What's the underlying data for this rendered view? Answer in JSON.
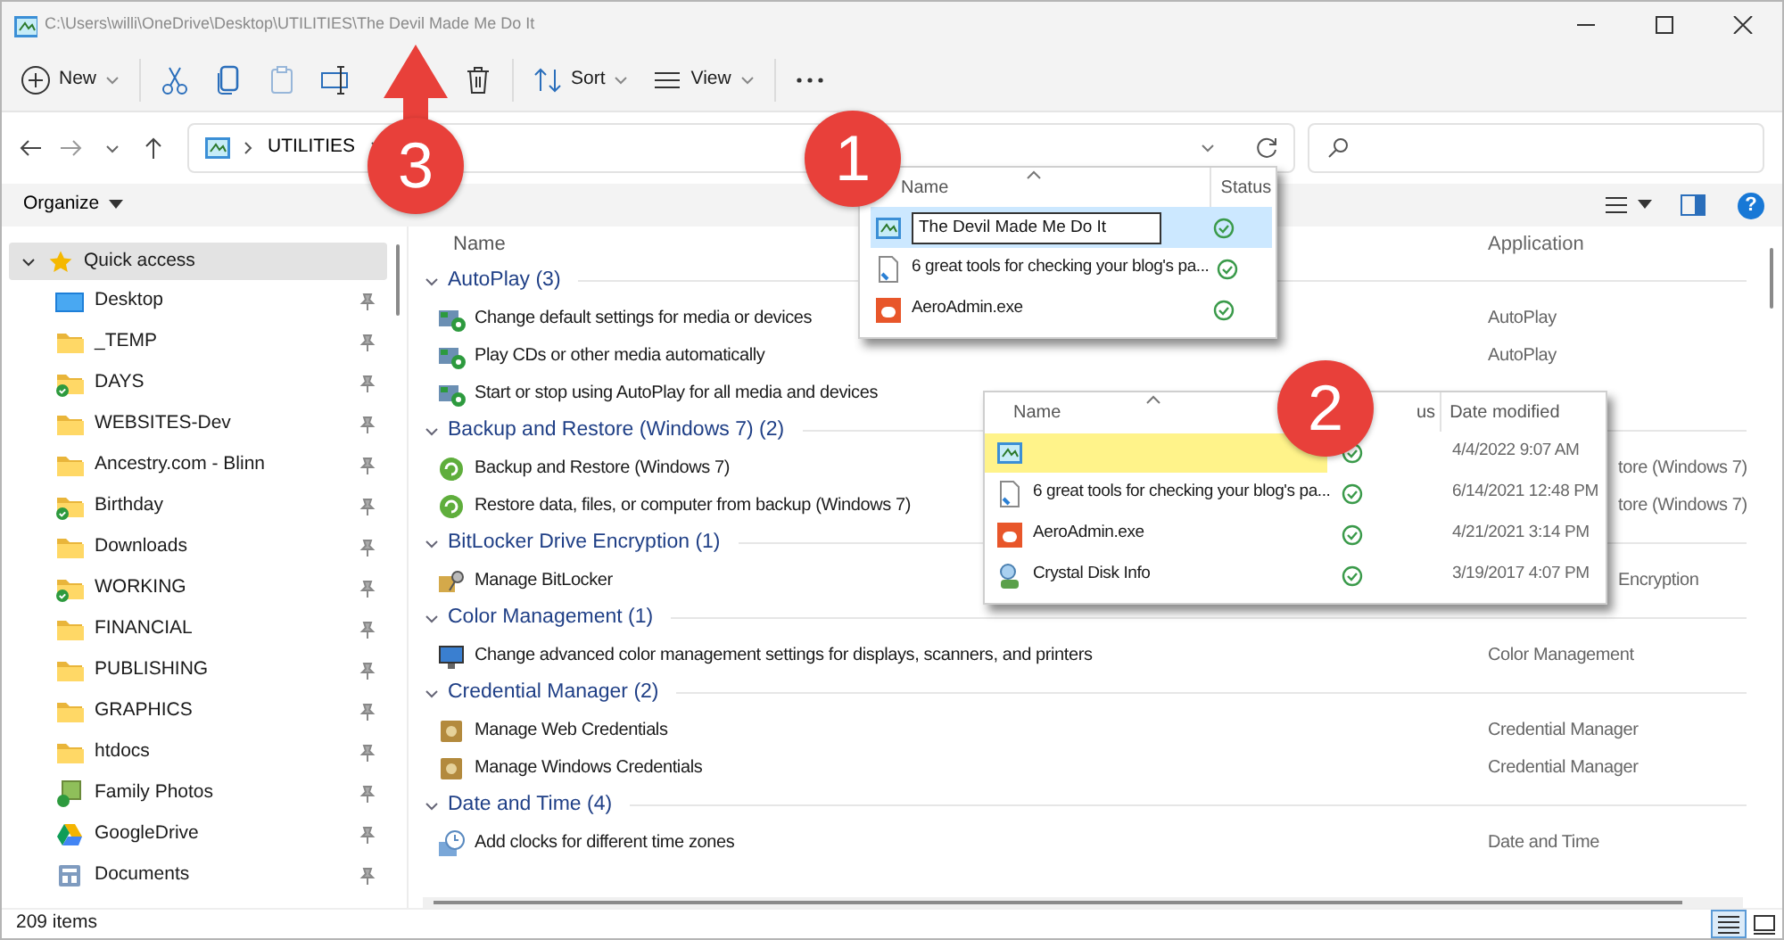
{
  "window": {
    "title": "C:\\Users\\willi\\OneDrive\\Desktop\\UTILITIES\\The Devil Made Me Do It"
  },
  "toolbar": [
    {
      "kind": "new",
      "label": "New",
      "disabled": false
    },
    {
      "kind": "cut",
      "disabled": false
    },
    {
      "kind": "copy",
      "disabled": false
    },
    {
      "kind": "paste",
      "disabled": true
    },
    {
      "kind": "rename",
      "disabled": false
    },
    {
      "kind": "delete",
      "disabled": false
    },
    {
      "kind": "sort",
      "label": "Sort",
      "disabled": false
    },
    {
      "kind": "view",
      "label": "View",
      "disabled": false
    },
    {
      "kind": "more",
      "disabled": false
    }
  ],
  "address": {
    "crumbs": [
      "UTILITIES"
    ]
  },
  "organize": {
    "label": "Organize",
    "help": "?"
  },
  "sidebar": {
    "quick_access": {
      "label": "Quick access",
      "expanded": true,
      "selected": true
    },
    "items": [
      {
        "label": "Desktop",
        "kind": "desktop",
        "pinned": true
      },
      {
        "label": "_TEMP",
        "kind": "folder",
        "pinned": true
      },
      {
        "label": "DAYS",
        "kind": "folder-synced",
        "pinned": true
      },
      {
        "label": "WEBSITES-Dev",
        "kind": "folder",
        "pinned": true
      },
      {
        "label": "Ancestry.com - Blinn",
        "kind": "folder",
        "pinned": true
      },
      {
        "label": "Birthday",
        "kind": "folder-synced",
        "pinned": true
      },
      {
        "label": "Downloads",
        "kind": "folder",
        "pinned": true
      },
      {
        "label": "WORKING",
        "kind": "folder-synced",
        "pinned": true
      },
      {
        "label": "FINANCIAL",
        "kind": "folder",
        "pinned": true
      },
      {
        "label": "PUBLISHING",
        "kind": "folder",
        "pinned": true
      },
      {
        "label": "GRAPHICS",
        "kind": "folder",
        "pinned": true
      },
      {
        "label": "htdocs",
        "kind": "folder",
        "pinned": true
      },
      {
        "label": "Family Photos",
        "kind": "photos",
        "pinned": true
      },
      {
        "label": "GoogleDrive",
        "kind": "drive",
        "pinned": true
      },
      {
        "label": "Documents",
        "kind": "documents",
        "pinned": true
      }
    ]
  },
  "content": {
    "columns": [
      "Name",
      "Application"
    ],
    "groups": [
      {
        "title": "AutoPlay (3)",
        "expanded": true,
        "items": [
          {
            "name": "Change default settings for media or devices",
            "kind": "autoplay",
            "application": "AutoPlay",
            "clipped": false
          },
          {
            "name": "Play CDs or other media automatically",
            "kind": "autoplay",
            "application": "AutoPlay",
            "clipped": false
          },
          {
            "name": "Start or stop using AutoPlay for all media and devices",
            "kind": "autoplay"
          }
        ]
      },
      {
        "title": "Backup and Restore (Windows 7) (2)",
        "expanded": true,
        "items": [
          {
            "name": "Backup and Restore (Windows 7)",
            "kind": "backup",
            "application": "tore (Windows 7)",
            "clipped": true
          },
          {
            "name": "Restore data, files, or computer from backup (Windows 7)",
            "kind": "backup",
            "application": "tore (Windows 7)",
            "clipped": true
          }
        ]
      },
      {
        "title": "BitLocker Drive Encryption (1)",
        "expanded": true,
        "items": [
          {
            "name": "Manage BitLocker",
            "kind": "bitlocker",
            "application": "Encryption",
            "clipped": true
          }
        ]
      },
      {
        "title": "Color Management (1)",
        "expanded": true,
        "items": [
          {
            "name": "Change advanced color management settings for displays, scanners, and printers",
            "kind": "color",
            "application": "Color Management",
            "clipped": false
          }
        ]
      },
      {
        "title": "Credential Manager (2)",
        "expanded": true,
        "items": [
          {
            "name": "Manage Web Credentials",
            "kind": "credential",
            "application": "Credential Manager",
            "clipped": false
          },
          {
            "name": "Manage Windows Credentials",
            "kind": "credential",
            "application": "Credential Manager",
            "clipped": false
          }
        ]
      },
      {
        "title": "Date and Time (4)",
        "expanded": true,
        "items": [
          {
            "name": "Add clocks for different time zones",
            "kind": "clock",
            "application": "Date and Time",
            "clipped": false
          }
        ]
      }
    ]
  },
  "popups": [
    {
      "columns": [
        {
          "label": "Name",
          "sorted": true
        },
        {
          "label": "Status",
          "sorted": false
        }
      ],
      "items": [
        {
          "kind": "shortcut",
          "name": "The Devil Made Me Do It",
          "editing": true,
          "selected": true,
          "synced": true
        },
        {
          "kind": "file",
          "name": "6 great tools for checking your blog's pa...",
          "editing": false,
          "selected": false,
          "synced": true
        },
        {
          "kind": "exe",
          "name": "AeroAdmin.exe",
          "editing": false,
          "selected": false,
          "synced": true
        }
      ]
    },
    {
      "columns": [
        {
          "label": "Name",
          "sorted": true
        },
        {
          "label": "us",
          "sorted": false
        },
        {
          "label": "Date modified",
          "sorted": false
        }
      ],
      "items": [
        {
          "kind": "shortcut",
          "highlighted": true,
          "synced": true,
          "date": "4/4/2022 9:07 AM"
        },
        {
          "kind": "file",
          "name": "6 great tools for checking your blog's pa...",
          "highlighted": false,
          "synced": true,
          "date": "6/14/2021 12:48 PM"
        },
        {
          "kind": "exe",
          "name": "AeroAdmin.exe",
          "highlighted": false,
          "synced": true,
          "date": "4/21/2021 3:14 PM"
        },
        {
          "kind": "person",
          "name": "Crystal Disk Info",
          "highlighted": false,
          "synced": true,
          "date": "3/19/2017 4:07 PM"
        }
      ]
    }
  ],
  "callouts": [
    {
      "label": "1",
      "kind": "circle"
    },
    {
      "label": "2",
      "kind": "circle"
    },
    {
      "label": "3",
      "kind": "arrow"
    }
  ],
  "status_bar": {
    "count": "209 items",
    "views": [
      {
        "kind": "details",
        "selected": true
      },
      {
        "kind": "tiles",
        "selected": false
      }
    ]
  }
}
